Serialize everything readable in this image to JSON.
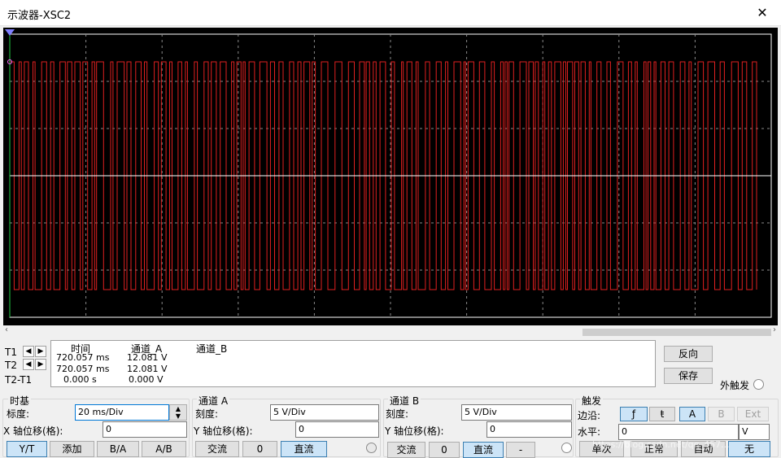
{
  "window": {
    "title": "示波器-XSC2",
    "close_symbol": "✕"
  },
  "screen": {
    "background": "#000000",
    "grid_color": "#8a8a8a",
    "trace_a_color": "#e02020",
    "cursor_color": "#ffffff",
    "trigger_marker_color": "#8080ff"
  },
  "scrollbar": {
    "left_arrow": "‹",
    "right_arrow": "›"
  },
  "readout": {
    "t1_label": "T1",
    "t2_label": "T2",
    "t2t1_label": "T2-T1",
    "arrow_left": "◀",
    "arrow_right": "▶",
    "headers": {
      "time": "时间",
      "channel_a": "通道_A",
      "channel_b": "通道_B"
    },
    "t1": {
      "time": "720.057 ms",
      "a": "12.081 V"
    },
    "t2": {
      "time": "720.057 ms",
      "a": "12.081 V"
    },
    "diff": {
      "time": "0.000 s",
      "a": "0.000 V"
    }
  },
  "buttons_right": {
    "reverse": "反向",
    "save": "保存",
    "ext_trigger": "外触发"
  },
  "timebase": {
    "title": "时基",
    "scale_label": "标度:",
    "scale_value": "20 ms/Div",
    "xpos_label": "X 轴位移(格):",
    "xpos_value": "0",
    "modes": [
      "Y/T",
      "添加",
      "B/A",
      "A/B"
    ],
    "active_mode": "Y/T"
  },
  "channel_a": {
    "title": "通道 A",
    "scale_label": "刻度:",
    "scale_value": "5  V/Div",
    "ypos_label": "Y 轴位移(格):",
    "ypos_value": "0",
    "coupling": [
      "交流",
      "0",
      "直流"
    ],
    "active_coupling": "直流"
  },
  "channel_b": {
    "title": "通道 B",
    "scale_label": "刻度:",
    "scale_value": "5  V/Div",
    "ypos_label": "Y 轴位移(格):",
    "ypos_value": "0",
    "coupling": [
      "交流",
      "0",
      "直流",
      "-"
    ],
    "active_coupling": "直流"
  },
  "trigger": {
    "title": "触发",
    "edge_label": "边沿:",
    "edge_rising": "ƒ",
    "edge_falling": "ŧ",
    "sources": [
      "A",
      "B",
      "Ext"
    ],
    "active_source": "A",
    "level_label": "水平:",
    "level_value": "0",
    "level_unit": "V",
    "modes": [
      "单次",
      "正常",
      "自动",
      "无"
    ],
    "active_mode": "无"
  },
  "watermark": "https://blog.csdn.net/qq_457..."
}
